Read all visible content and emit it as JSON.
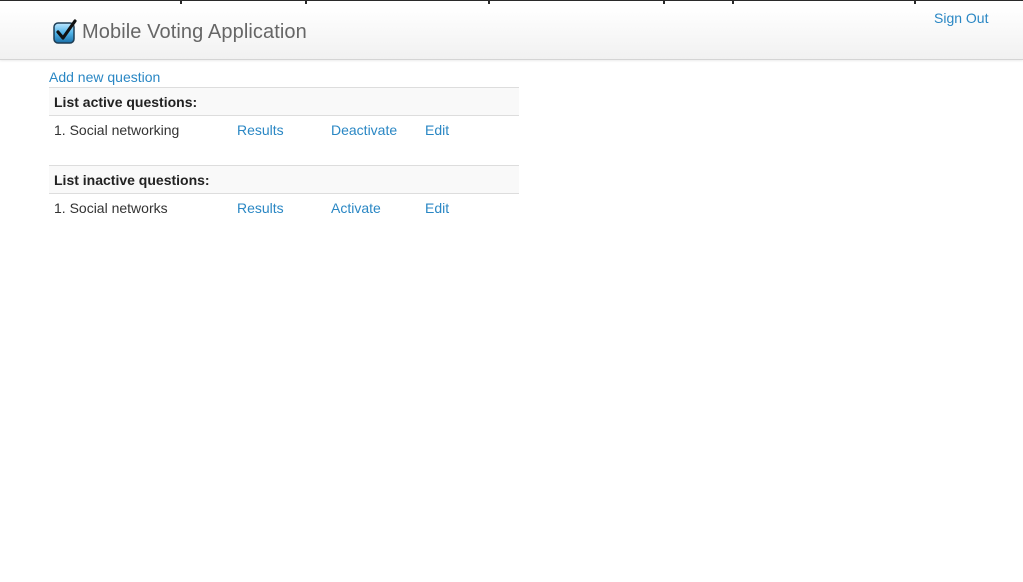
{
  "app": {
    "title": "Mobile Voting Application",
    "sign_out_label": "Sign Out",
    "logo_icon": "checkbox-checked-icon"
  },
  "actions": {
    "add_new_question_label": "Add new question"
  },
  "active_section": {
    "heading": "List active questions:",
    "rows": [
      {
        "question": "1. Social networking",
        "results_label": "Results",
        "toggle_label": "Deactivate",
        "edit_label": "Edit"
      }
    ]
  },
  "inactive_section": {
    "heading": "List inactive questions:",
    "rows": [
      {
        "question": "1. Social networks",
        "results_label": "Results",
        "toggle_label": "Activate",
        "edit_label": "Edit"
      }
    ]
  },
  "colors": {
    "link": "#2a87c4",
    "header_bg": "#f4f4f4",
    "table_heading_bg": "#f9f9f9",
    "border": "#dddddd"
  }
}
